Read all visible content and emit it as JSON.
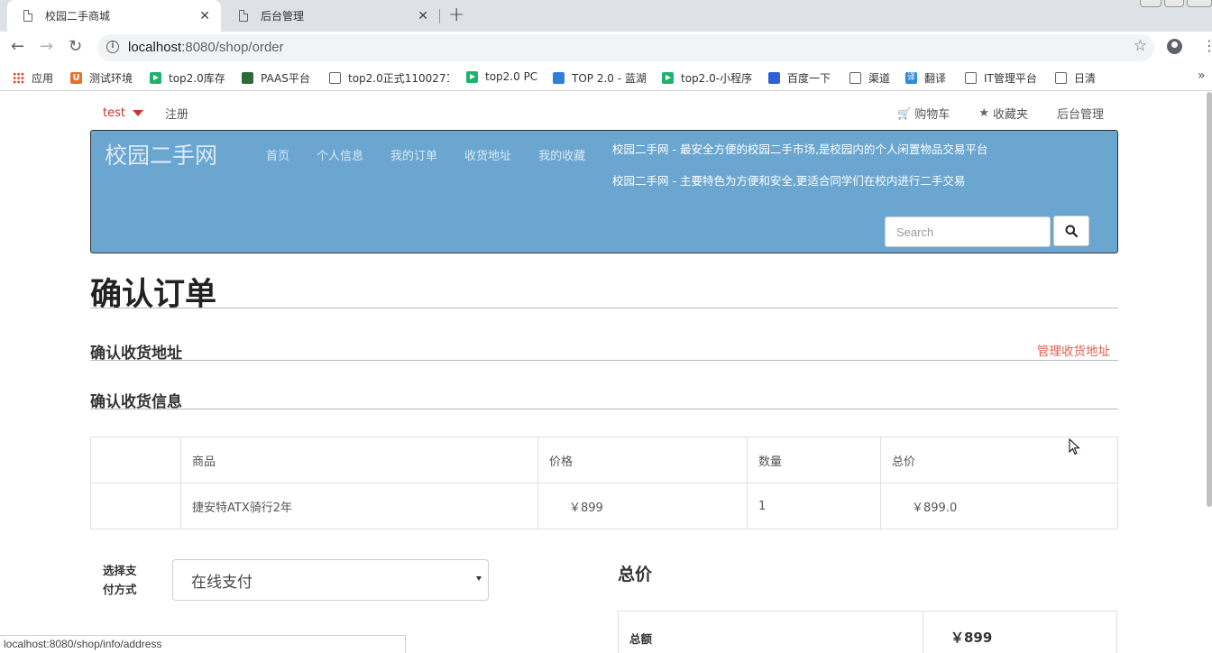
{
  "browser": {
    "tabs": [
      {
        "title": "校园二手商城",
        "active": true
      },
      {
        "title": "后台管理",
        "active": false
      }
    ],
    "url_host": "localhost",
    "url_rest": ":8080/shop/order",
    "bookmarks": [
      {
        "label": "应用",
        "icon": "apps-icon"
      },
      {
        "label": "测试环境",
        "icon": "u-logo-icon"
      },
      {
        "label": "top2.0库存",
        "icon": "play-icon"
      },
      {
        "label": "PAAS平台",
        "icon": "paas-icon"
      },
      {
        "label": "top2.0正式1100271",
        "icon": "doc-icon"
      },
      {
        "label": "top2.0 PC",
        "icon": "play-icon"
      },
      {
        "label": "TOP 2.0 - 蓝湖",
        "icon": "lanhu-icon"
      },
      {
        "label": "top2.0-小程序",
        "icon": "play-icon"
      },
      {
        "label": "百度一下",
        "icon": "baidu-paw-icon"
      },
      {
        "label": "渠道",
        "icon": "doc-icon"
      },
      {
        "label": "翻译",
        "icon": "translate-icon"
      },
      {
        "label": "IT管理平台",
        "icon": "doc-icon"
      },
      {
        "label": "日清",
        "icon": "doc-icon"
      }
    ],
    "status_url": "localhost:8080/shop/info/address"
  },
  "topnav": {
    "user": "test",
    "register": "注册",
    "cart": "购物车",
    "favorites": "收藏夹",
    "admin": "后台管理"
  },
  "banner": {
    "brand": "校园二手网",
    "nav": [
      "首页",
      "个人信息",
      "我的订单",
      "收货地址",
      "我的收藏"
    ],
    "slogan1": "校园二手网 - 最安全方便的校园二手市场,是校园内的个人闲置物品交易平台",
    "slogan2": "校园二手网 - 主要特色为方便和安全,更适合同学们在校内进行二手交易",
    "search_placeholder": "Search",
    "bg_color": "#6aa6d0"
  },
  "main": {
    "title": "确认订单",
    "address_heading": "确认收货地址",
    "manage_address": "管理收货地址",
    "info_heading": "确认收货信息",
    "table": {
      "headers": [
        "",
        "商品",
        "价格",
        "数量",
        "总价"
      ],
      "rows": [
        [
          "",
          "捷安特ATX骑行2年",
          "￥899",
          "1",
          "￥899.0"
        ]
      ]
    },
    "pay_label": "选择支付方式",
    "pay_value": "在线支付",
    "total_heading": "总价",
    "total_label": "总额",
    "total_value": "￥899"
  }
}
